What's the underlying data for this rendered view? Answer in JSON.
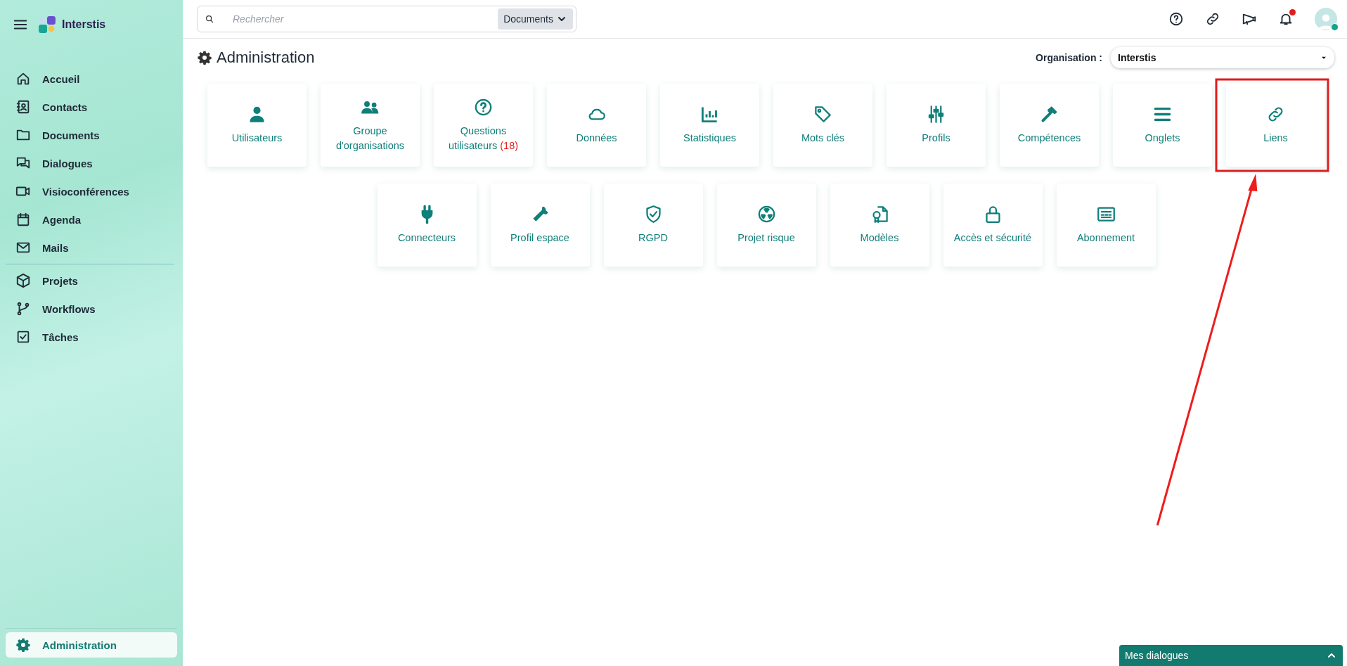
{
  "brand": {
    "name": "Interstis"
  },
  "sidebar": {
    "groups": [
      [
        {
          "label": "Accueil",
          "selected": false
        },
        {
          "label": "Contacts",
          "selected": false
        },
        {
          "label": "Documents",
          "selected": false
        },
        {
          "label": "Dialogues",
          "selected": false
        },
        {
          "label": "Visioconférences",
          "selected": false
        },
        {
          "label": "Agenda",
          "selected": false
        },
        {
          "label": "Mails",
          "selected": false
        }
      ],
      [
        {
          "label": "Projets",
          "selected": false
        },
        {
          "label": "Workflows",
          "selected": false
        },
        {
          "label": "Tâches",
          "selected": false
        }
      ]
    ],
    "footer_item": {
      "label": "Administration",
      "selected": true
    }
  },
  "search": {
    "placeholder": "Rechercher",
    "scope": "Documents"
  },
  "header": {
    "has_notification": true,
    "user_online": true
  },
  "page": {
    "title": "Administration",
    "organisation_label": "Organisation :",
    "organisation": "Interstis"
  },
  "tiles": [
    {
      "label": "Utilisateurs",
      "highlighted": false
    },
    {
      "label": "Groupe d'organisations",
      "highlighted": false
    },
    {
      "label": "Questions utilisateurs",
      "count": "(18)",
      "highlighted": false
    },
    {
      "label": "Données",
      "highlighted": false
    },
    {
      "label": "Statistiques",
      "highlighted": false
    },
    {
      "label": "Mots clés",
      "highlighted": false
    },
    {
      "label": "Profils",
      "highlighted": false
    },
    {
      "label": "Compétences",
      "highlighted": false
    },
    {
      "label": "Onglets",
      "highlighted": false
    },
    {
      "label": "Liens",
      "highlighted": true
    },
    {
      "label": "Connecteurs",
      "highlighted": false
    },
    {
      "label": "Profil espace",
      "highlighted": false
    },
    {
      "label": "RGPD",
      "highlighted": false
    },
    {
      "label": "Projet risque",
      "highlighted": false
    },
    {
      "label": "Modèles",
      "highlighted": false
    },
    {
      "label": "Accès et sécurité",
      "highlighted": false
    },
    {
      "label": "Abonnement",
      "highlighted": false
    }
  ],
  "dock": {
    "label": "Mes dialogues"
  }
}
